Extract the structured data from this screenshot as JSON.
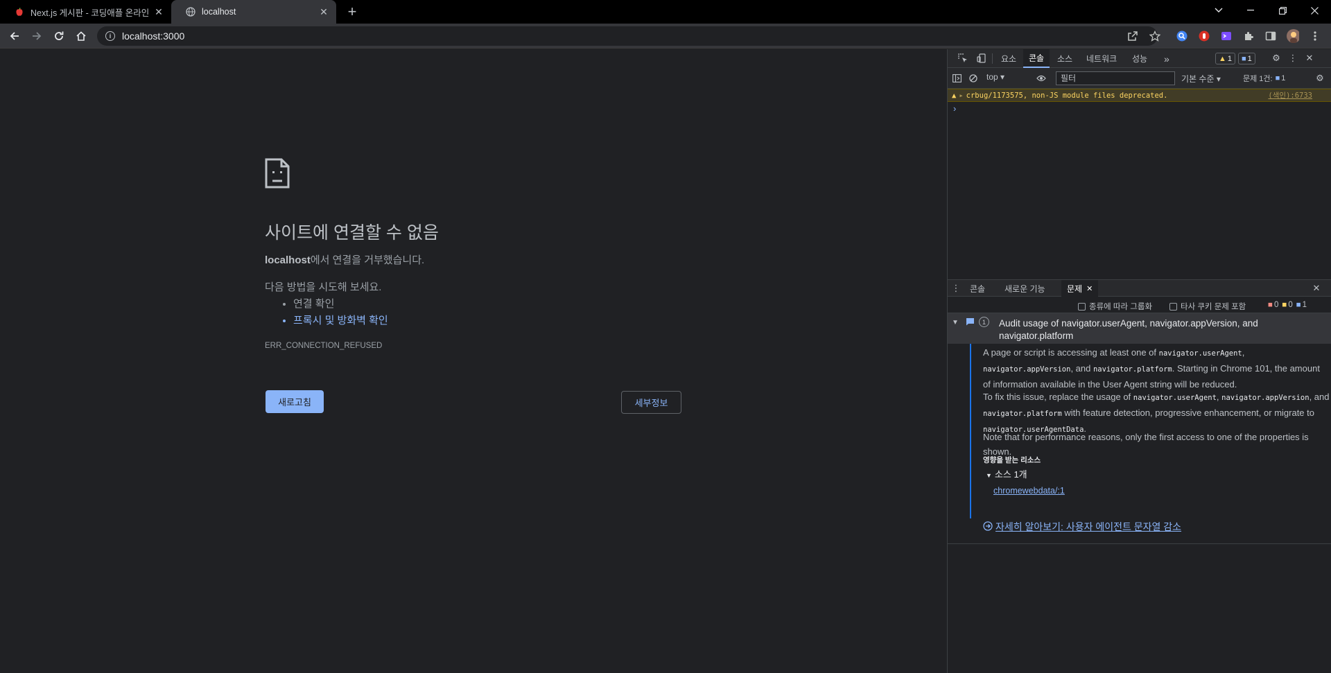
{
  "browser": {
    "tabs": [
      {
        "title": "Next.js 게시판 - 코딩애플 온라인"
      },
      {
        "title": "localhost"
      }
    ],
    "new_tab_label": "+",
    "address": "localhost:3000"
  },
  "error_page": {
    "title": "사이트에 연결할 수 없음",
    "host": "localhost",
    "desc_suffix": "에서 연결을 거부했습니다.",
    "try_label": "다음 방법을 시도해 보세요.",
    "suggestions": [
      "연결 확인",
      "프록시 및 방화벽 확인"
    ],
    "error_code": "ERR_CONNECTION_REFUSED",
    "reload_label": "새로고침",
    "details_label": "세부정보"
  },
  "devtools": {
    "tabs": [
      "요소",
      "콘솔",
      "소스",
      "네트워크",
      "성능"
    ],
    "more_tabs": "»",
    "warn_count": "1",
    "info_count": "1",
    "context": "top",
    "filter_placeholder": "필터",
    "log_level": "기본 수준",
    "issues_summary": "문제 1건:",
    "issues_summary_count": "1",
    "warning_message": "crbug/1173575, non-JS module files deprecated.",
    "warning_source": "(색인):6733",
    "prompt": "›",
    "drawer": {
      "tabs": [
        "콘솔",
        "새로운 기능",
        "문제"
      ],
      "group_by_kind": "종류에 따라 그룹화",
      "third_party": "타사 쿠키 문제 포함",
      "counts": {
        "errors": "0",
        "warnings": "0",
        "info": "1"
      }
    },
    "issue": {
      "count": "1",
      "title": "Audit usage of navigator.userAgent, navigator.appVersion, and navigator.platform",
      "p1_a": "A page or script is accessing at least one of ",
      "p1_code1": "navigator.userAgent",
      "p1_b": ", ",
      "p1_code2": "navigator.appVersion",
      "p1_c": ", and ",
      "p1_code3": "navigator.platform",
      "p1_d": ". Starting in Chrome 101, the amount of information available in the User Agent string will be reduced.",
      "p2_a": "To fix this issue, replace the usage of ",
      "p2_code1": "navigator.userAgent",
      "p2_b": ", ",
      "p2_code2": "navigator.appVersion",
      "p2_c": ", and ",
      "p2_code3": "navigator.platform",
      "p2_d": " with feature detection, progressive enhancement, or migrate to ",
      "p2_code4": "navigator.userAgentData",
      "p2_e": ".",
      "p3": "Note that for performance reasons, only the first access to one of the properties is shown.",
      "affected_label": "영향을 받는 리소스",
      "sources_label": "소스 1개",
      "source_link": "chromewebdata/:1",
      "learn_more": "자세히 알아보기: 사용자 에이전트 문자열 감소"
    }
  },
  "colors": {
    "accent": "#8ab4f8",
    "warning": "#fcd462",
    "page_bg": "#202124"
  }
}
